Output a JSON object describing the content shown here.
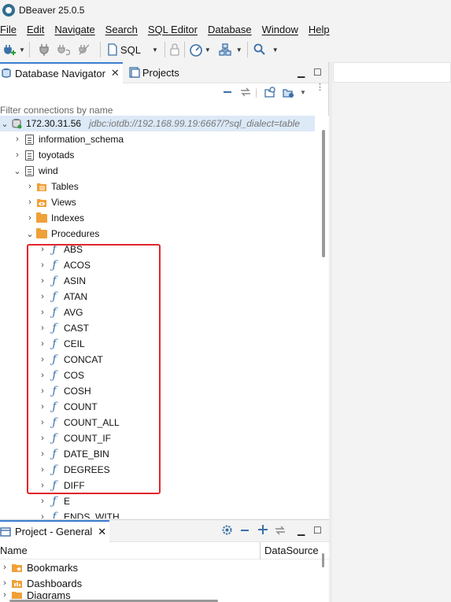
{
  "window": {
    "title": "DBeaver 25.0.5"
  },
  "menu": [
    "File",
    "Edit",
    "Navigate",
    "Search",
    "SQL Editor",
    "Database",
    "Window",
    "Help"
  ],
  "toolbar": {
    "sql_label": "SQL"
  },
  "navigator": {
    "tabs": [
      {
        "label": "Database Navigator",
        "close": "✕"
      },
      {
        "label": "Projects"
      }
    ],
    "filter_placeholder": "Filter connections by name",
    "connection": {
      "host": "172.30.31.56",
      "url": "jdbc:iotdb://192.168.99.19:6667/?sql_dialect=table"
    },
    "databases": [
      "information_schema",
      "toyotads",
      "wind"
    ],
    "folders": [
      "Tables",
      "Views",
      "Indexes",
      "Procedures"
    ],
    "functions": [
      "ABS",
      "ACOS",
      "ASIN",
      "ATAN",
      "AVG",
      "CAST",
      "CEIL",
      "CONCAT",
      "COS",
      "COSH",
      "COUNT",
      "COUNT_ALL",
      "COUNT_IF",
      "DATE_BIN",
      "DEGREES",
      "DIFF",
      "E"
    ],
    "cut_off_label": "ENDS_WITH"
  },
  "project": {
    "tab_label": "Project - General",
    "close": "✕",
    "columns": [
      "Name",
      "DataSource"
    ],
    "items": [
      "Bookmarks",
      "Dashboards",
      "Diagrams"
    ]
  },
  "colors": {
    "accent": "#3c7ecf",
    "highlight": "#e0262b",
    "folder": "#f0a038",
    "function": "#3b6fa7"
  }
}
